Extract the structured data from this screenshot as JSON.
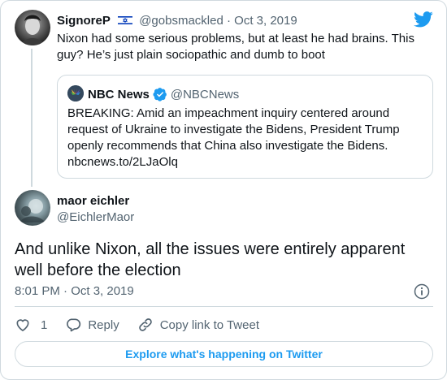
{
  "colors": {
    "brand": "#1d9bf0",
    "text": "#0f1419",
    "muted": "#536471",
    "border": "#cfd9de"
  },
  "parent_tweet": {
    "name": "SignoreP",
    "flag_icon": "israel-flag-icon",
    "handle": "@gobsmackled",
    "separator": " · ",
    "date": "Oct 3, 2019",
    "text": "Nixon had some serious problems, but at least he had brains. This guy? He’s just plain sociopathic and dumb to boot",
    "quoted": {
      "name": "NBC News",
      "verified_icon": "verified-badge-icon",
      "handle": "@NBCNews",
      "text": "BREAKING: Amid an impeachment inquiry centered around request of Ukraine to investigate the Bidens, President Trump openly recommends that China also investigate the Bidens.",
      "link": "nbcnews.to/2LJaOlq"
    }
  },
  "main_tweet": {
    "name": "maor eichler",
    "handle": "@EichlerMaor",
    "text": "And unlike Nixon, all the issues were entirely apparent well before the election",
    "timestamp": "8:01 PM · Oct 3, 2019"
  },
  "actions": {
    "like_count": "1",
    "reply_label": "Reply",
    "copy_label": "Copy link to Tweet"
  },
  "explore_label": "Explore what's happening on Twitter"
}
